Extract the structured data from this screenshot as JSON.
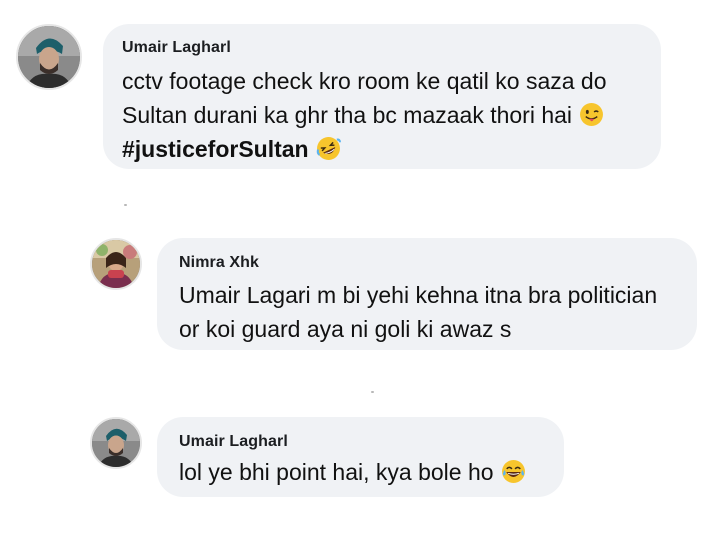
{
  "comments": [
    {
      "author": "Umair Lagharl",
      "lines": [
        "cctv footage check kro room ke qatil ko saza do",
        "Sultan durani ka ghr tha bc mazaak thori hai"
      ],
      "line2_emoji": "winking-tongue-emoji",
      "hashtag": "#justiceforSultan",
      "hashtag_emoji": "rolling-laughing-emoji"
    },
    {
      "author": "Nimra Xhk",
      "lines": [
        "Umair Lagari m bi yehi kehna itna bra politician",
        "or koi guard aya ni goli ki awaz s"
      ]
    },
    {
      "author": "Umair Lagharl",
      "lines": [
        "lol ye bhi point hai, kya bole ho"
      ],
      "line1_emoji": "tears-of-joy-emoji"
    }
  ],
  "colors": {
    "bubble": "#f0f2f5",
    "page_background": "#ffffff",
    "text": "#111111",
    "emoji_yellow": "#f7c52d"
  }
}
